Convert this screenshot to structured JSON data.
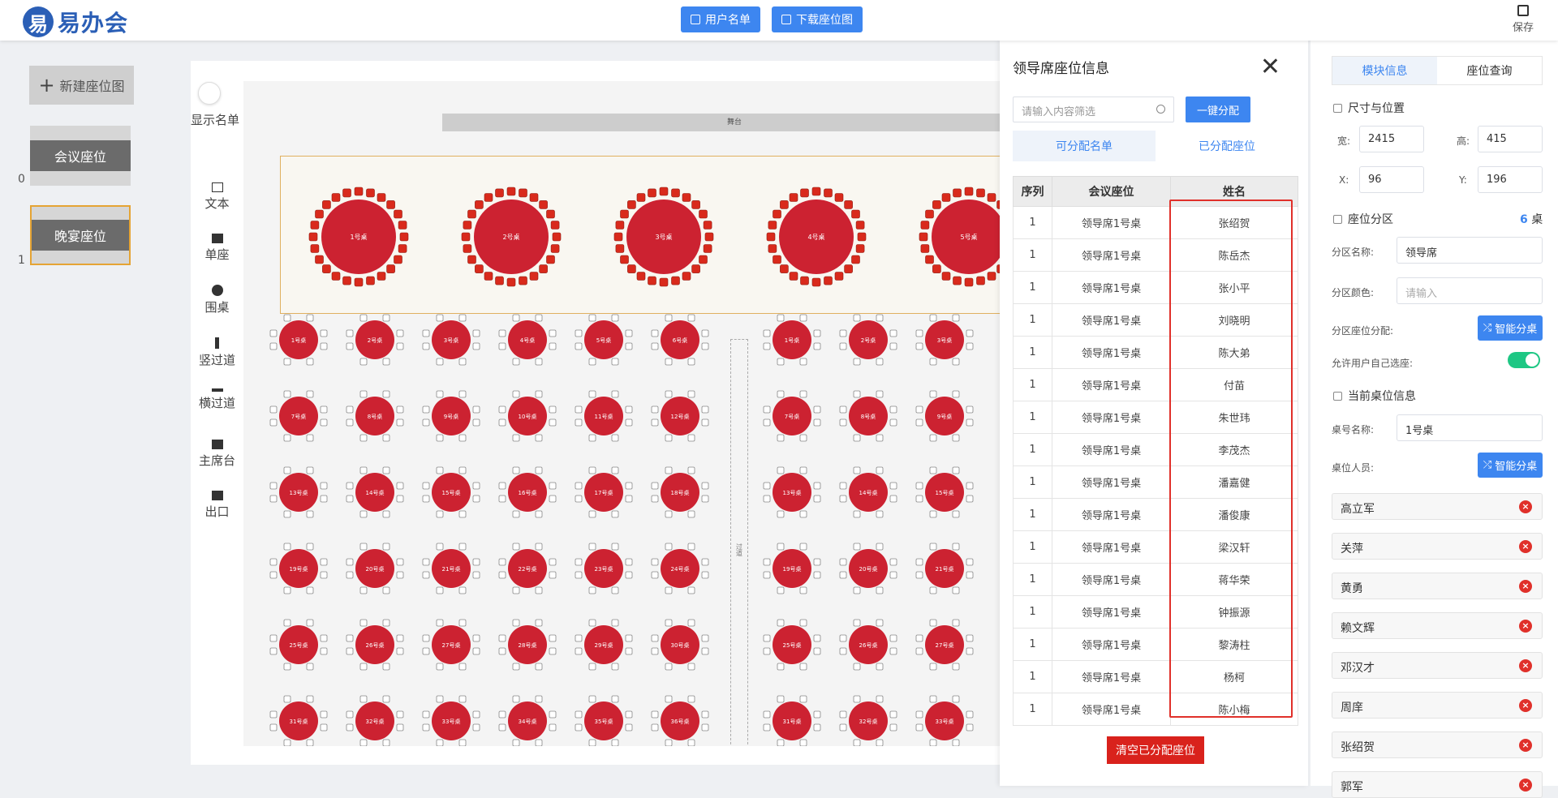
{
  "app": {
    "logo_text": "易办会",
    "logo_mark": "易"
  },
  "toolbar": {
    "user_list": "用户名单",
    "download": "下载座位图",
    "save": "保存"
  },
  "sidebar": {
    "new_layout": "新建座位图",
    "templates": [
      {
        "label": "会议座位",
        "count": "0"
      },
      {
        "label": "晚宴座位",
        "count": "1"
      }
    ]
  },
  "tools": {
    "toggle_label": "显示名单",
    "items": [
      {
        "label": "文本",
        "icon": "text-icon"
      },
      {
        "label": "单座",
        "icon": "seat-icon"
      },
      {
        "label": "围桌",
        "icon": "round-table-icon"
      },
      {
        "label": "竖过道",
        "icon": "vertical-aisle-icon"
      },
      {
        "label": "横过道",
        "icon": "horizontal-aisle-icon"
      },
      {
        "label": "主席台",
        "icon": "podium-icon"
      },
      {
        "label": "出口",
        "icon": "exit-icon"
      }
    ]
  },
  "stage": {
    "stage_label": "舞台",
    "aisle_label": "过道",
    "vip_tables": [
      "1号桌",
      "2号桌",
      "3号桌",
      "4号桌",
      "5号桌"
    ],
    "left_tables": [
      "1号桌",
      "2号桌",
      "3号桌",
      "4号桌",
      "5号桌",
      "6号桌",
      "7号桌",
      "8号桌",
      "9号桌",
      "10号桌",
      "11号桌",
      "12号桌",
      "13号桌",
      "14号桌",
      "15号桌",
      "16号桌",
      "17号桌",
      "18号桌",
      "19号桌",
      "20号桌",
      "21号桌",
      "22号桌",
      "23号桌",
      "24号桌",
      "25号桌",
      "26号桌",
      "27号桌",
      "28号桌",
      "29号桌",
      "30号桌",
      "31号桌",
      "32号桌",
      "33号桌",
      "34号桌",
      "35号桌",
      "36号桌"
    ],
    "right_tables": [
      "1号桌",
      "2号桌",
      "3号桌",
      "7号桌",
      "8号桌",
      "9号桌",
      "13号桌",
      "14号桌",
      "15号桌",
      "19号桌",
      "20号桌",
      "21号桌",
      "25号桌",
      "26号桌",
      "27号桌",
      "31号桌",
      "32号桌",
      "33号桌"
    ],
    "colors": {
      "table": "#cc2231",
      "vip_chair": "#d92a1c"
    }
  },
  "panel": {
    "title": "领导席座位信息",
    "filter_placeholder": "请输入内容筛选",
    "assign_all": "一键分配",
    "tabs": [
      "可分配名单",
      "已分配座位"
    ],
    "columns": [
      "序列",
      "会议座位",
      "姓名"
    ],
    "rows": [
      [
        "1",
        "领导席1号桌",
        "张绍贺"
      ],
      [
        "1",
        "领导席1号桌",
        "陈岳杰"
      ],
      [
        "1",
        "领导席1号桌",
        "张小平"
      ],
      [
        "1",
        "领导席1号桌",
        "刘晓明"
      ],
      [
        "1",
        "领导席1号桌",
        "陈大弟"
      ],
      [
        "1",
        "领导席1号桌",
        "付苗"
      ],
      [
        "1",
        "领导席1号桌",
        "朱世玮"
      ],
      [
        "1",
        "领导席1号桌",
        "李茂杰"
      ],
      [
        "1",
        "领导席1号桌",
        "潘嘉健"
      ],
      [
        "1",
        "领导席1号桌",
        "潘俊康"
      ],
      [
        "1",
        "领导席1号桌",
        "梁汉轩"
      ],
      [
        "1",
        "领导席1号桌",
        "蒋华荣"
      ],
      [
        "1",
        "领导席1号桌",
        "钟振源"
      ],
      [
        "1",
        "领导席1号桌",
        "黎涛柱"
      ],
      [
        "1",
        "领导席1号桌",
        "杨柯"
      ],
      [
        "1",
        "领导席1号桌",
        "陈小梅"
      ]
    ],
    "clear": "清空已分配座位"
  },
  "right": {
    "tabs": [
      "模块信息",
      "座位查询"
    ],
    "size_section": "尺寸与位置",
    "width_label": "宽:",
    "width": "2415",
    "height_label": "高:",
    "height": "415",
    "x_label": "X:",
    "x": "96",
    "y_label": "Y:",
    "y": "196",
    "zone_section": "座位分区",
    "zone_count": "6",
    "zone_unit": "桌",
    "zone_name_label": "分区名称:",
    "zone_name": "领导席",
    "zone_color_label": "分区颜色:",
    "zone_color_placeholder": "请输入",
    "zone_assign_label": "分区座位分配:",
    "smart": "智能分桌",
    "allow_label": "允许用户自己选座:",
    "table_section": "当前桌位信息",
    "table_name_label": "桌号名称:",
    "table_name": "1号桌",
    "table_people_label": "桌位人员:",
    "people": [
      "高立军",
      "关萍",
      "黄勇",
      "赖文辉",
      "邓汉才",
      "周庠",
      "张绍贺",
      "郭军"
    ]
  }
}
